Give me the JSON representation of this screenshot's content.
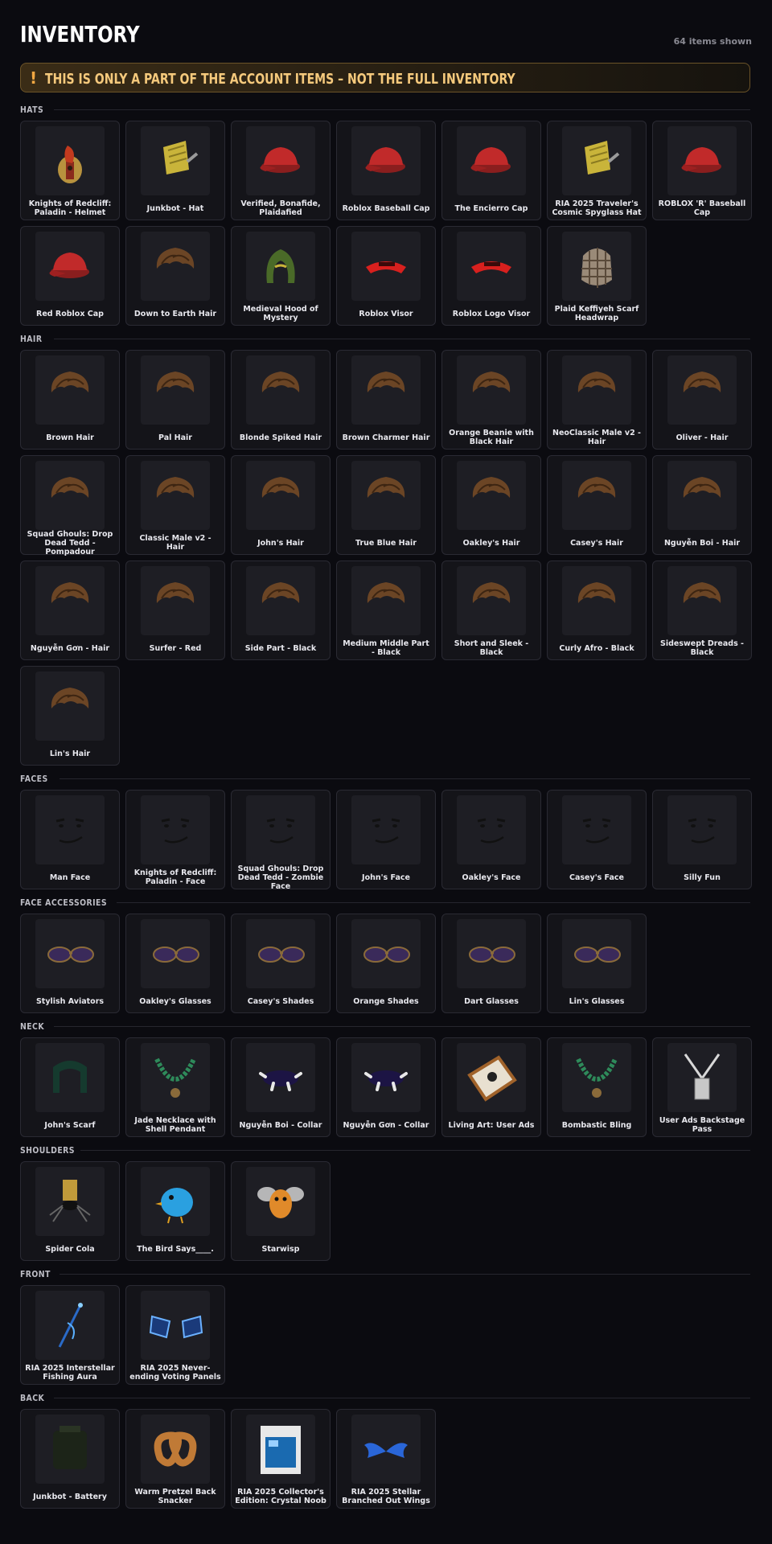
{
  "header": {
    "title": "INVENTORY",
    "count": "64 items shown"
  },
  "banner": {
    "icon": "exclamation-icon",
    "bang": "!",
    "text": "THIS IS ONLY A PART OF THE ACCOUNT ITEMS – NOT THE FULL INVENTORY"
  },
  "colors": {
    "background": "#0b0b10",
    "card": "#141419",
    "banner_text": "#f5c97c",
    "banner_border": "#6b5328"
  },
  "sections": [
    {
      "label": "HATS",
      "items": [
        {
          "name": "Knights of Redcliff: Paladin - Helmet",
          "icon": "helmet-icon"
        },
        {
          "name": "Junkbot - Hat",
          "icon": "hat-icon"
        },
        {
          "name": "Verified, Bonafide, Plaidafied",
          "icon": "cap-icon"
        },
        {
          "name": "Roblox Baseball Cap",
          "icon": "cap-icon"
        },
        {
          "name": "The Encierro Cap",
          "icon": "cap-icon"
        },
        {
          "name": "RIA 2025 Traveler's Cosmic Spyglass Hat",
          "icon": "hat-icon"
        },
        {
          "name": "ROBLOX 'R' Baseball Cap",
          "icon": "cap-icon"
        },
        {
          "name": "Red Roblox Cap",
          "icon": "cap-icon"
        },
        {
          "name": "Down to Earth Hair",
          "icon": "hair-icon"
        },
        {
          "name": "Medieval Hood of Mystery",
          "icon": "hood-icon"
        },
        {
          "name": "Roblox Visor",
          "icon": "visor-icon"
        },
        {
          "name": "Roblox Logo Visor",
          "icon": "visor-icon"
        },
        {
          "name": "Plaid Keffiyeh Scarf Headwrap",
          "icon": "headwrap-icon"
        }
      ]
    },
    {
      "label": "HAIR",
      "items": [
        {
          "name": "Brown Hair",
          "icon": "hair-icon"
        },
        {
          "name": "Pal Hair",
          "icon": "hair-icon"
        },
        {
          "name": "Blonde Spiked Hair",
          "icon": "hair-icon"
        },
        {
          "name": "Brown Charmer Hair",
          "icon": "hair-icon"
        },
        {
          "name": "Orange Beanie with Black Hair",
          "icon": "hair-icon"
        },
        {
          "name": "NeoClassic Male v2 - Hair",
          "icon": "hair-icon"
        },
        {
          "name": "Oliver - Hair",
          "icon": "hair-icon"
        },
        {
          "name": "Squad Ghouls: Drop Dead Tedd - Pompadour",
          "icon": "hair-icon"
        },
        {
          "name": "Classic Male v2 - Hair",
          "icon": "hair-icon"
        },
        {
          "name": "John's Hair",
          "icon": "hair-icon"
        },
        {
          "name": "True Blue Hair",
          "icon": "hair-icon"
        },
        {
          "name": "Oakley's Hair",
          "icon": "hair-icon"
        },
        {
          "name": "Casey's Hair",
          "icon": "hair-icon"
        },
        {
          "name": "Nguyễn Boi - Hair",
          "icon": "hair-icon"
        },
        {
          "name": "Nguyễn Gơn - Hair",
          "icon": "hair-icon"
        },
        {
          "name": "Surfer - Red",
          "icon": "hair-icon"
        },
        {
          "name": "Side Part - Black",
          "icon": "hair-icon"
        },
        {
          "name": "Medium Middle Part - Black",
          "icon": "hair-icon"
        },
        {
          "name": "Short and Sleek - Black",
          "icon": "hair-icon"
        },
        {
          "name": "Curly Afro - Black",
          "icon": "hair-icon"
        },
        {
          "name": "Sideswept Dreads - Black",
          "icon": "hair-icon"
        },
        {
          "name": "Lin's Hair",
          "icon": "hair-icon"
        }
      ]
    },
    {
      "label": "FACES",
      "items": [
        {
          "name": "Man Face",
          "icon": "face-icon"
        },
        {
          "name": "Knights of Redcliff: Paladin - Face",
          "icon": "face-icon"
        },
        {
          "name": "Squad Ghouls: Drop Dead Tedd - Zombie Face",
          "icon": "face-icon"
        },
        {
          "name": "John's Face",
          "icon": "face-icon"
        },
        {
          "name": "Oakley's Face",
          "icon": "face-icon"
        },
        {
          "name": "Casey's Face",
          "icon": "face-icon"
        },
        {
          "name": "Silly Fun",
          "icon": "face-icon"
        }
      ]
    },
    {
      "label": "FACE ACCESSORIES",
      "items": [
        {
          "name": "Stylish Aviators",
          "icon": "glasses-icon"
        },
        {
          "name": "Oakley's Glasses",
          "icon": "glasses-icon"
        },
        {
          "name": "Casey's Shades",
          "icon": "glasses-icon"
        },
        {
          "name": "Orange Shades",
          "icon": "glasses-icon"
        },
        {
          "name": "Dart Glasses",
          "icon": "glasses-icon"
        },
        {
          "name": "Lin's Glasses",
          "icon": "glasses-icon"
        }
      ]
    },
    {
      "label": "NECK",
      "items": [
        {
          "name": "John's Scarf",
          "icon": "scarf-icon"
        },
        {
          "name": "Jade Necklace with Shell Pendant",
          "icon": "necklace-icon"
        },
        {
          "name": "Nguyễn Boi - Collar",
          "icon": "collar-icon"
        },
        {
          "name": "Nguyễn Gơn - Collar",
          "icon": "collar-icon"
        },
        {
          "name": "Living Art: User Ads",
          "icon": "frame-icon"
        },
        {
          "name": "Bombastic Bling",
          "icon": "necklace-icon"
        },
        {
          "name": "User Ads Backstage Pass",
          "icon": "lanyard-icon"
        }
      ]
    },
    {
      "label": "SHOULDERS",
      "items": [
        {
          "name": "Spider Cola",
          "icon": "spider-icon"
        },
        {
          "name": "The Bird Says____.",
          "icon": "bird-icon"
        },
        {
          "name": "Starwisp",
          "icon": "bug-icon"
        }
      ]
    },
    {
      "label": "FRONT",
      "items": [
        {
          "name": "RIA 2025 Interstellar Fishing Aura",
          "icon": "aura-icon"
        },
        {
          "name": "RIA 2025 Never-ending Voting Panels",
          "icon": "panels-icon"
        }
      ]
    },
    {
      "label": "BACK",
      "items": [
        {
          "name": "Junkbot - Battery",
          "icon": "battery-icon"
        },
        {
          "name": "Warm Pretzel Back Snacker",
          "icon": "pretzel-icon"
        },
        {
          "name": "RIA 2025 Collector's Edition: Crystal Noob",
          "icon": "box-icon"
        },
        {
          "name": "RIA 2025 Stellar Branched Out Wings",
          "icon": "wings-icon"
        }
      ]
    }
  ]
}
